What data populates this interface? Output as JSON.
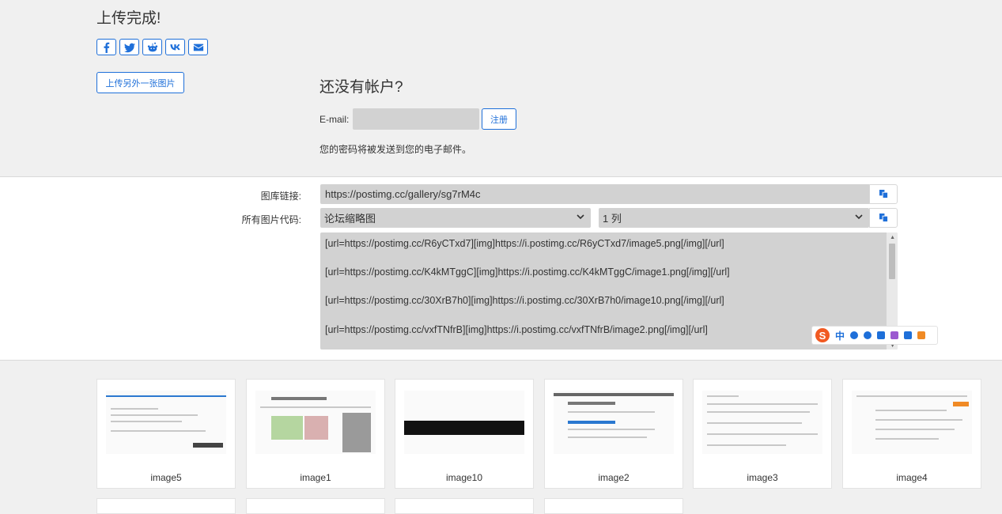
{
  "header": {
    "title": "上传完成!",
    "share_buttons": [
      {
        "icon": "facebook-icon"
      },
      {
        "icon": "twitter-icon"
      },
      {
        "icon": "reddit-icon"
      },
      {
        "icon": "vk-icon"
      },
      {
        "icon": "email-icon"
      }
    ],
    "upload_another_label": "上传另外一张图片"
  },
  "signup": {
    "heading": "还没有帐户?",
    "email_label": "E-mail:",
    "email_value": "",
    "register_label": "注册",
    "password_note": "您的密码将被发送到您的电子邮件。"
  },
  "links": {
    "gallery_label": "图库链接:",
    "gallery_url": "https://postimg.cc/gallery/sg7rM4c",
    "codes_label": "所有图片代码:",
    "format_selected": "论坛缩略图",
    "columns_selected": "1 列",
    "codes": [
      "[url=https://postimg.cc/R6yCTxd7][img]https://i.postimg.cc/R6yCTxd7/image5.png[/img][/url]",
      "[url=https://postimg.cc/K4kMTggC][img]https://i.postimg.cc/K4kMTggC/image1.png[/img][/url]",
      "[url=https://postimg.cc/30XrB7h0][img]https://i.postimg.cc/30XrB7h0/image10.png[/img][/url]",
      "[url=https://postimg.cc/vxfTNfrB][img]https://i.postimg.cc/vxfTNfrB/image2.png[/img][/url]"
    ]
  },
  "ime_toolbar": {
    "logo": "S",
    "mode": "中"
  },
  "thumbnails": [
    {
      "name": "image5"
    },
    {
      "name": "image1"
    },
    {
      "name": "image10"
    },
    {
      "name": "image2"
    },
    {
      "name": "image3"
    },
    {
      "name": "image4"
    }
  ],
  "colors": {
    "accent": "#1e6fd9",
    "background": "#f0f0f0",
    "field": "#d2d2d2"
  }
}
